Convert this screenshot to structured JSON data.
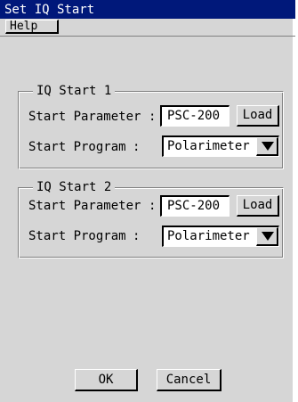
{
  "window": {
    "title": "Set IQ Start"
  },
  "menubar": {
    "help_label": "Help"
  },
  "groups": [
    {
      "title": "IQ Start 1",
      "param_label": "Start Parameter",
      "param_value": "PSC-200",
      "load_label": "Load",
      "program_label": "Start Program",
      "program_value": "Polarimeter"
    },
    {
      "title": "IQ Start 2",
      "param_label": "Start Parameter",
      "param_value": "PSC-200",
      "load_label": "Load",
      "program_label": "Start Program",
      "program_value": "Polarimeter"
    }
  ],
  "separator": ":",
  "footer": {
    "ok_label": "OK",
    "cancel_label": "Cancel"
  },
  "icons": {
    "dropdown": "triangle-down-icon"
  },
  "colors": {
    "titlebar": "#00187a",
    "panel": "#d6d6d6"
  }
}
